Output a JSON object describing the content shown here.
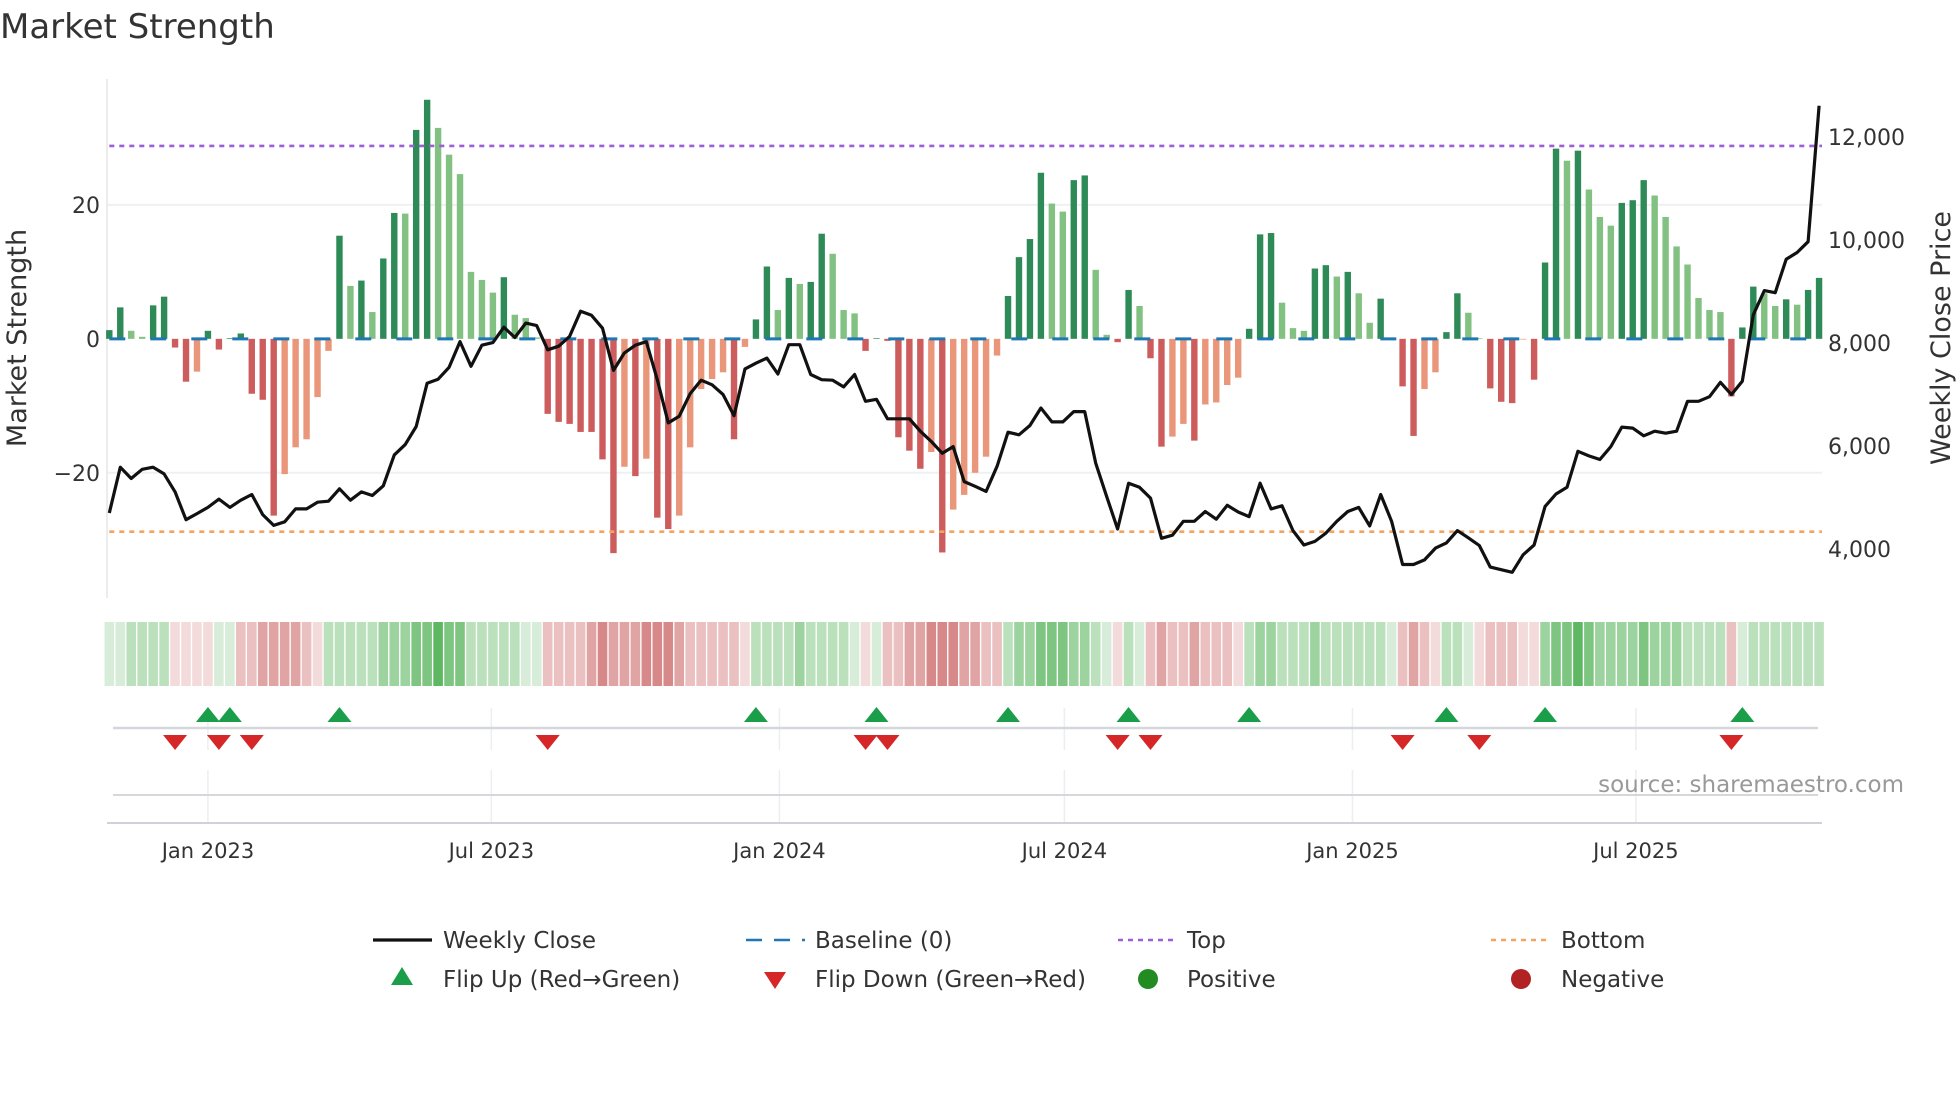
{
  "title": "Market Strength",
  "source": "source: sharemaestro.com",
  "legend": {
    "weekly_close": "Weekly Close",
    "baseline": "Baseline (0)",
    "top": "Top",
    "bottom": "Bottom",
    "flip_up": "Flip Up (Red→Green)",
    "flip_down": "Flip Down (Green→Red)",
    "positive": "Positive",
    "negative": "Negative"
  },
  "colors": {
    "bar_pos_rising": "#2e8b57",
    "bar_pos_falling": "#82c182",
    "bar_neg_falling": "#cd5c5c",
    "bar_neg_rising": "#e9967a",
    "price_line": "#111111",
    "baseline": "#1f77b4",
    "top": "#9b5fd6",
    "bottom": "#f4a460",
    "flip_up": "#1a9e4a",
    "flip_down": "#d62728",
    "positive": "#228b22",
    "negative": "#b22222",
    "strip_green": "#4caf50",
    "strip_red": "#c85a5a"
  },
  "chart_data": {
    "type": "bar",
    "title": "Market Strength",
    "ylabel": "Market Strength",
    "y2label": "Weekly Close Price",
    "x_start": "2022-10-30",
    "x_step_days": 7,
    "ylim": [
      -38.7,
      38.8
    ],
    "y2lim": [
      3050,
      13130
    ],
    "yticks": [
      {
        "v": 20,
        "label": "20"
      },
      {
        "v": 0,
        "label": "0"
      },
      {
        "v": -20,
        "label": "−20"
      }
    ],
    "y2ticks": [
      {
        "v": 12000,
        "label": "12,000"
      },
      {
        "v": 10000,
        "label": "10,000"
      },
      {
        "v": 8000,
        "label": "8,000"
      },
      {
        "v": 6000,
        "label": "6,000"
      },
      {
        "v": 4000,
        "label": "4,000"
      }
    ],
    "xticks": [
      {
        "date": "2023-01-01",
        "label": "Jan 2023"
      },
      {
        "date": "2023-07-01",
        "label": "Jul 2023"
      },
      {
        "date": "2024-01-01",
        "label": "Jan 2024"
      },
      {
        "date": "2024-07-01",
        "label": "Jul 2024"
      },
      {
        "date": "2025-01-01",
        "label": "Jan 2025"
      },
      {
        "date": "2025-07-01",
        "label": "Jul 2025"
      }
    ],
    "top_level": 28.8,
    "bottom_level": -28.8,
    "baseline": 0,
    "grid": true,
    "legend_position": "bottom",
    "strength": [
      1.3,
      4.7,
      1.2,
      0.3,
      5.0,
      6.3,
      -1.3,
      -6.4,
      -4.9,
      1.2,
      -1.6,
      0.1,
      0.8,
      -8.2,
      -9.1,
      -26.4,
      -20.2,
      -16.2,
      -15.0,
      -8.7,
      -1.8,
      15.4,
      7.9,
      8.7,
      4.0,
      12.0,
      18.8,
      18.7,
      31.2,
      35.7,
      31.5,
      27.5,
      24.6,
      10.0,
      8.8,
      6.9,
      9.2,
      3.6,
      3.1,
      0.2,
      -11.2,
      -12.4,
      -12.7,
      -13.9,
      -13.9,
      -18.0,
      -32.0,
      -19.1,
      -20.5,
      -17.9,
      -26.7,
      -28.4,
      -26.4,
      -16.2,
      -7.5,
      -6.0,
      -5.0,
      -15.0,
      -1.2,
      2.9,
      10.8,
      4.3,
      9.1,
      8.2,
      8.5,
      15.7,
      12.7,
      4.3,
      3.8,
      -1.8,
      0.1,
      -0.3,
      -14.7,
      -16.7,
      -19.4,
      -16.9,
      -31.9,
      -25.5,
      -23.3,
      -20.0,
      -17.6,
      -2.5,
      6.4,
      12.2,
      14.9,
      24.8,
      20.2,
      19.0,
      23.7,
      24.4,
      10.3,
      0.6,
      -0.5,
      7.3,
      4.9,
      -2.9,
      -16.1,
      -14.6,
      -12.7,
      -15.2,
      -9.8,
      -9.5,
      -6.9,
      -5.8,
      1.5,
      15.6,
      15.8,
      5.4,
      1.6,
      1.2,
      10.5,
      11.0,
      9.3,
      10.0,
      6.8,
      2.4,
      6.0,
      0.1,
      -7.1,
      -14.5,
      -7.5,
      -5.0,
      1.0,
      6.8,
      3.9,
      0.1,
      -7.4,
      -9.4,
      -9.6,
      -0.1,
      -6.1,
      11.4,
      28.4,
      26.6,
      28.1,
      22.3,
      18.2,
      16.9,
      20.3,
      20.7,
      23.7,
      21.4,
      18.2,
      13.8,
      11.1,
      6.1,
      4.3,
      4.0,
      -8.6,
      1.7,
      7.8,
      6.8,
      4.9,
      5.9,
      5.1,
      7.3,
      9.1
    ],
    "weekly_close": [
      4700,
      5590,
      5370,
      5550,
      5590,
      5460,
      5110,
      4570,
      4690,
      4810,
      4970,
      4810,
      4950,
      5060,
      4670,
      4460,
      4530,
      4780,
      4780,
      4910,
      4930,
      5170,
      4950,
      5110,
      5040,
      5230,
      5830,
      6030,
      6380,
      7220,
      7300,
      7530,
      8030,
      7550,
      7960,
      8010,
      8310,
      8110,
      8390,
      8340,
      7870,
      7940,
      8130,
      8620,
      8540,
      8290,
      7470,
      7810,
      7960,
      8030,
      7290,
      6450,
      6580,
      7020,
      7280,
      7190,
      7000,
      6590,
      7500,
      7610,
      7710,
      7400,
      7970,
      7970,
      7390,
      7290,
      7280,
      7150,
      7390,
      6870,
      6910,
      6530,
      6530,
      6530,
      6290,
      6090,
      5860,
      5990,
      5310,
      5220,
      5120,
      5610,
      6270,
      6220,
      6400,
      6740,
      6470,
      6470,
      6670,
      6670,
      5670,
      5020,
      4390,
      5280,
      5200,
      4990,
      4210,
      4270,
      4540,
      4540,
      4730,
      4580,
      4850,
      4720,
      4630,
      5280,
      4780,
      4840,
      4360,
      4080,
      4150,
      4310,
      4540,
      4730,
      4810,
      4450,
      5060,
      4540,
      3700,
      3700,
      3790,
      4020,
      4120,
      4360,
      4220,
      4070,
      3650,
      3600,
      3550,
      3890,
      4080,
      4830,
      5070,
      5200,
      5900,
      5810,
      5740,
      5990,
      6370,
      6350,
      6200,
      6290,
      6250,
      6290,
      6870,
      6870,
      6960,
      7240,
      7000,
      7260,
      8550,
      9020,
      8980,
      9630,
      9760,
      9970,
      12610
    ],
    "regime_strip": [
      1,
      1,
      2,
      2,
      2,
      2,
      -1,
      -1,
      -1,
      -1,
      1,
      1,
      -2,
      -2,
      -3,
      -3,
      -3,
      -3,
      -2,
      -1,
      2,
      2,
      2,
      2,
      2,
      3,
      3,
      3,
      4,
      4,
      5,
      4,
      4,
      2,
      2,
      2,
      2,
      2,
      1,
      1,
      -2,
      -2,
      -2,
      -2,
      -3,
      -4,
      -3,
      -3,
      -3,
      -4,
      -4,
      -4,
      -3,
      -2,
      -2,
      -2,
      -2,
      -2,
      -1,
      2,
      2,
      2,
      2,
      3,
      2,
      2,
      2,
      2,
      1,
      -1,
      1,
      -2,
      -2,
      -3,
      -3,
      -4,
      -4,
      -4,
      -3,
      -3,
      -2,
      -2,
      2,
      3,
      3,
      4,
      4,
      4,
      3,
      3,
      2,
      1,
      -1,
      2,
      1,
      -2,
      -3,
      -2,
      -2,
      -3,
      -2,
      -2,
      -2,
      -1,
      2,
      3,
      3,
      2,
      2,
      2,
      3,
      2,
      2,
      2,
      2,
      2,
      2,
      1,
      -2,
      -3,
      -2,
      -1,
      2,
      2,
      1,
      -1,
      -2,
      -2,
      -2,
      -1,
      -1,
      3,
      4,
      4,
      5,
      4,
      3,
      3,
      3,
      3,
      4,
      3,
      3,
      3,
      2,
      2,
      2,
      2,
      -2,
      1,
      2,
      2,
      2,
      2,
      2,
      2,
      2
    ],
    "flip_up_weeks": [
      9,
      11,
      21,
      59,
      70,
      82,
      93,
      104,
      122,
      131,
      149
    ],
    "flip_down_weeks": [
      6,
      10,
      13,
      40,
      69,
      71,
      92,
      95,
      118,
      125,
      148
    ]
  }
}
